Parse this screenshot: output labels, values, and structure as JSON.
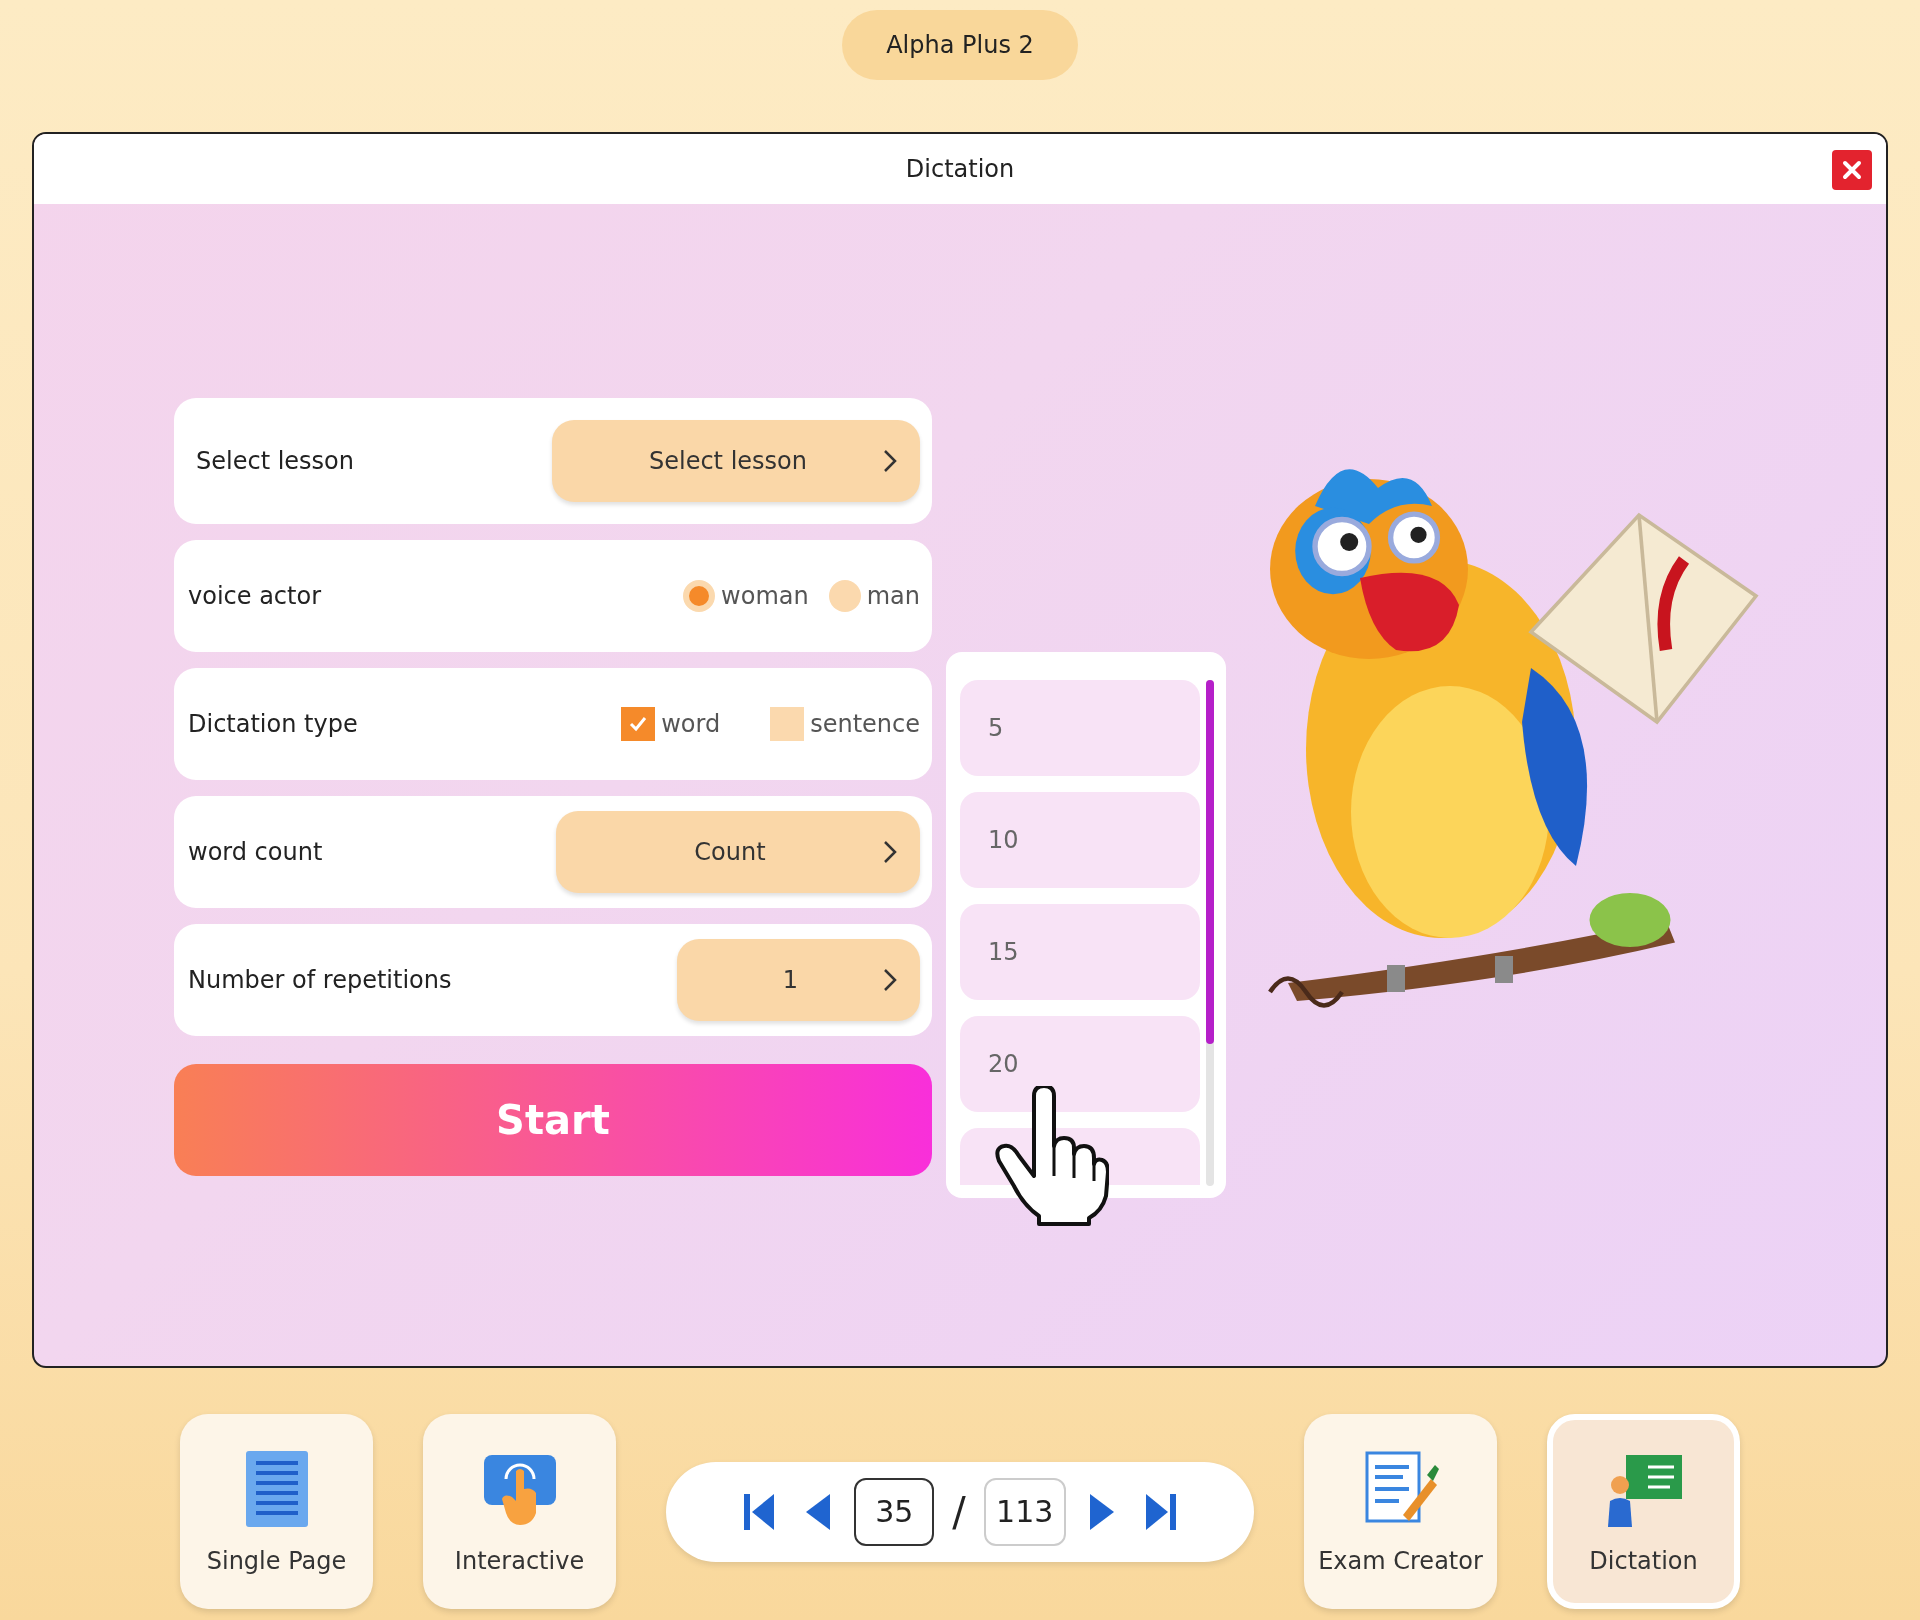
{
  "app_title": "Alpha Plus 2",
  "window": {
    "title": "Dictation"
  },
  "form": {
    "rows": [
      {
        "kind": "select",
        "label": "Select lesson",
        "value": "Select lesson"
      },
      {
        "kind": "radio",
        "label": "voice actor",
        "options": [
          {
            "label": "woman",
            "selected": true
          },
          {
            "label": "man",
            "selected": false
          }
        ]
      },
      {
        "kind": "checkbox",
        "label": "Dictation type",
        "options": [
          {
            "label": "word",
            "checked": true
          },
          {
            "label": "sentence",
            "checked": false
          }
        ]
      },
      {
        "kind": "select",
        "label": "word count",
        "value": "Count"
      },
      {
        "kind": "select",
        "label": "Number of repetitions",
        "value": "1"
      }
    ],
    "start_button": "Start"
  },
  "count_dropdown": {
    "options": [
      "5",
      "10",
      "15",
      "20"
    ]
  },
  "toolbar": {
    "left_buttons": [
      {
        "kind": "page",
        "label": "Single Page",
        "selected": false
      },
      {
        "kind": "touch",
        "label": "Interactive",
        "selected": false
      }
    ],
    "pager": {
      "page": "35",
      "separator": "/",
      "total": "113"
    },
    "right_buttons": [
      {
        "kind": "exam",
        "label": "Exam Creator",
        "selected": false
      },
      {
        "kind": "dictation",
        "label": "Dictation",
        "selected": true
      }
    ]
  }
}
